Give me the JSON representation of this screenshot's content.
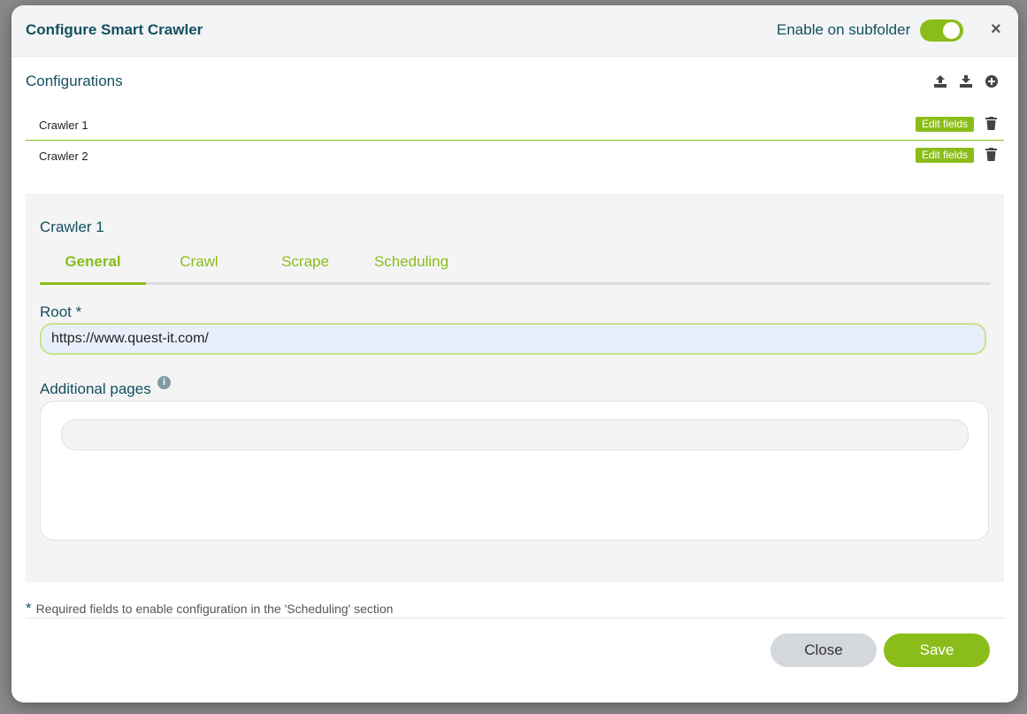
{
  "modal": {
    "title": "Configure Smart Crawler",
    "subfolder_label": "Enable on subfolder",
    "subfolder_enabled": true,
    "close_symbol": "×"
  },
  "configurations": {
    "title": "Configurations",
    "header_icons": [
      "upload-icon",
      "download-icon",
      "add-circle-icon"
    ],
    "edit_label": "Edit fields",
    "items": [
      {
        "label": "Crawler 1"
      },
      {
        "label": "Crawler 2"
      }
    ]
  },
  "detail": {
    "title": "Crawler 1",
    "tabs": [
      {
        "label": "General",
        "active": true
      },
      {
        "label": "Crawl",
        "active": false
      },
      {
        "label": "Scrape",
        "active": false
      },
      {
        "label": "Scheduling",
        "active": false
      }
    ],
    "root_label": "Root *",
    "root_value": "https://www.quest-it.com/",
    "additional_pages_label": "Additional pages",
    "info_symbol": "i"
  },
  "footer": {
    "star": "*",
    "note": "Required fields to enable configuration in the 'Scheduling' section",
    "close_label": "Close",
    "save_label": "Save"
  },
  "colors": {
    "accent": "#8bbd1a",
    "title": "#14505e",
    "panel_bg": "#f4f4f5"
  }
}
